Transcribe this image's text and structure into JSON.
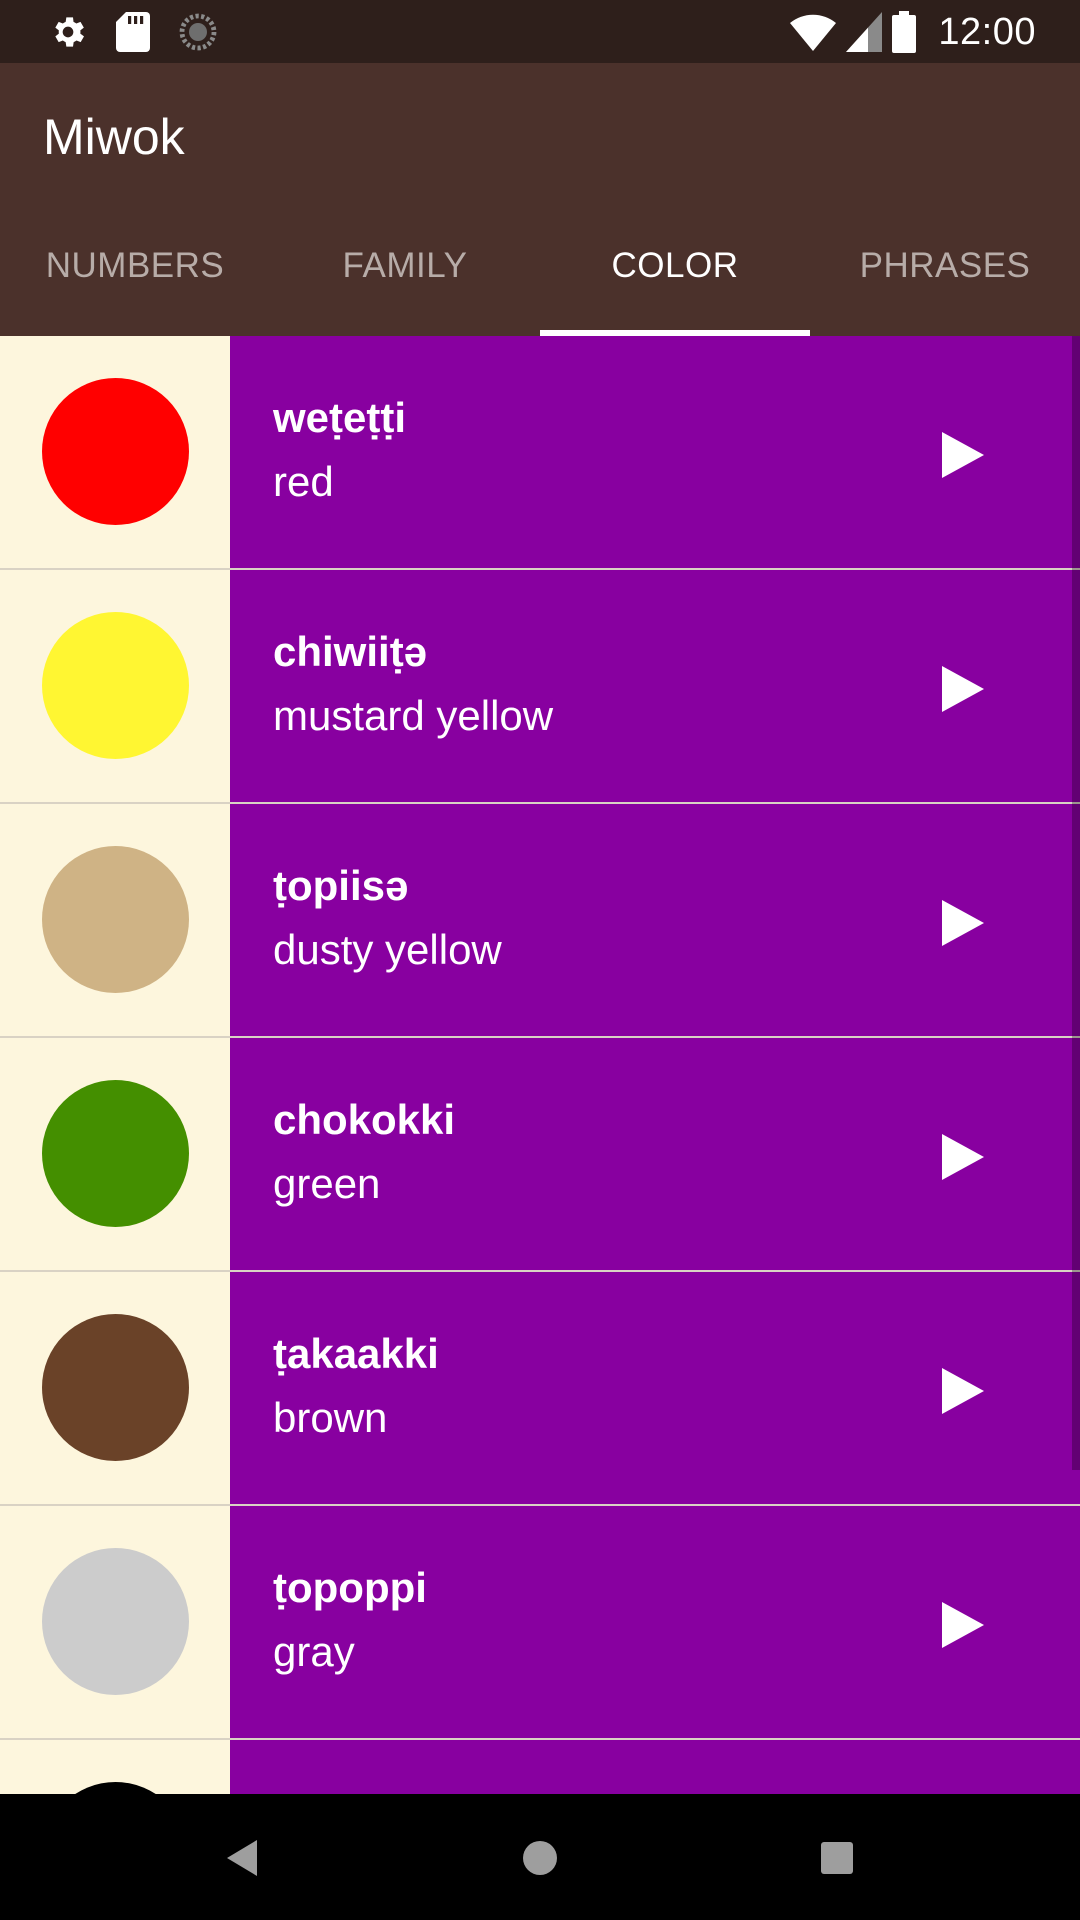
{
  "status_bar": {
    "time": "12:00",
    "left_icons": [
      "settings-gear-icon",
      "sd-card-icon",
      "loading-circle-icon"
    ],
    "right_icons": [
      "wifi-icon",
      "cell-signal-icon",
      "battery-icon"
    ]
  },
  "app_bar": {
    "title": "Miwok",
    "tabs": [
      {
        "label": "NUMBERS",
        "active": false
      },
      {
        "label": "FAMILY",
        "active": false
      },
      {
        "label": "COLOR",
        "active": true
      },
      {
        "label": "PHRASES",
        "active": false
      }
    ]
  },
  "list": {
    "items": [
      {
        "miwok": "weṭeṭṭi",
        "english": "red",
        "color": "#ff0000"
      },
      {
        "miwok": "chiwiiṭə",
        "english": "mustard yellow",
        "color": "#fff632"
      },
      {
        "miwok": "ṭopiisə",
        "english": "dusty yellow",
        "color": "#cfb385"
      },
      {
        "miwok": "chokokki",
        "english": "green",
        "color": "#448f00"
      },
      {
        "miwok": "ṭakaakki",
        "english": "brown",
        "color": "#6a4228"
      },
      {
        "miwok": "ṭopoppi",
        "english": "gray",
        "color": "#cccccc"
      },
      {
        "miwok": "",
        "english": "",
        "color": "#000000"
      }
    ],
    "play_icon": "play-icon",
    "row_background": "#8800a0",
    "swatch_background": "#fdf6dd"
  },
  "nav_bar": {
    "buttons": [
      "back-icon",
      "home-icon",
      "recents-icon"
    ]
  }
}
